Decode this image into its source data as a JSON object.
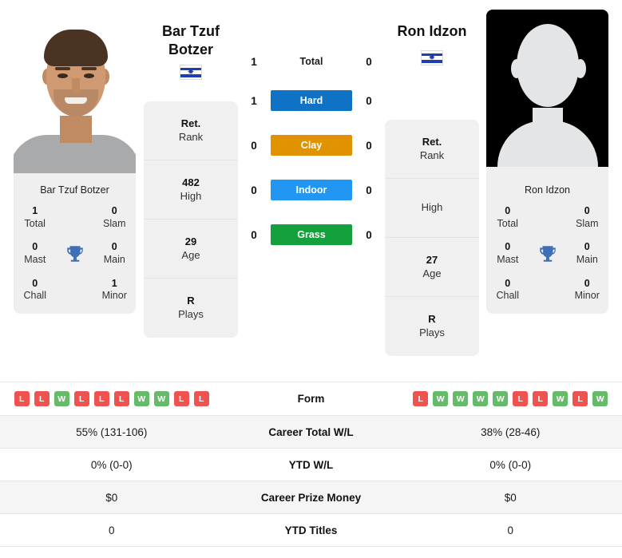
{
  "colors": {
    "win": "#66bb6a",
    "loss": "#ef5350",
    "hard": "#0f72c4",
    "clay": "#e09200",
    "indoor": "#2196f3",
    "grass": "#14a03c",
    "trophy": "#3f6fb5"
  },
  "players": {
    "left": {
      "name_line1": "Bar Tzuf",
      "name_line2": "Botzer",
      "flag": "israel-flag",
      "photo": "player-headshot",
      "titles_name": "Bar Tzuf Botzer",
      "titles": [
        {
          "value": "1",
          "label": "Total"
        },
        {
          "value": "0",
          "label": "Slam"
        },
        {
          "value": "0",
          "label": "Mast"
        },
        {
          "value": "0",
          "label": "Main"
        },
        {
          "value": "0",
          "label": "Chall"
        },
        {
          "value": "1",
          "label": "Minor"
        }
      ],
      "stats": [
        {
          "value": "Ret.",
          "label": "Rank"
        },
        {
          "value": "482",
          "label": "High"
        },
        {
          "value": "29",
          "label": "Age"
        },
        {
          "value": "R",
          "label": "Plays"
        }
      ],
      "form": [
        "L",
        "L",
        "W",
        "L",
        "L",
        "L",
        "W",
        "W",
        "L",
        "L"
      ],
      "career_total_wl": "55% (131-106)",
      "ytd_wl": "0% (0-0)",
      "career_prize_money": "$0",
      "ytd_titles": "0"
    },
    "right": {
      "name_line1": "Ron Idzon",
      "name_line2": "",
      "flag": "israel-flag",
      "photo": "player-placeholder-silhouette",
      "titles_name": "Ron Idzon",
      "titles": [
        {
          "value": "0",
          "label": "Total"
        },
        {
          "value": "0",
          "label": "Slam"
        },
        {
          "value": "0",
          "label": "Mast"
        },
        {
          "value": "0",
          "label": "Main"
        },
        {
          "value": "0",
          "label": "Chall"
        },
        {
          "value": "0",
          "label": "Minor"
        }
      ],
      "stats": [
        {
          "value": "Ret.",
          "label": "Rank"
        },
        {
          "value": "",
          "label": "High"
        },
        {
          "value": "27",
          "label": "Age"
        },
        {
          "value": "R",
          "label": "Plays"
        }
      ],
      "form": [
        "L",
        "W",
        "W",
        "W",
        "W",
        "L",
        "L",
        "W",
        "L",
        "W"
      ],
      "career_total_wl": "38% (28-46)",
      "ytd_wl": "0% (0-0)",
      "career_prize_money": "$0",
      "ytd_titles": "0"
    }
  },
  "h2h": {
    "total": {
      "label": "Total",
      "left": "1",
      "right": "0"
    },
    "surfaces": [
      {
        "label": "Hard",
        "left": "1",
        "right": "0",
        "color": "#0f72c4"
      },
      {
        "label": "Clay",
        "left": "0",
        "right": "0",
        "color": "#e09200"
      },
      {
        "label": "Indoor",
        "left": "0",
        "right": "0",
        "color": "#2196f3"
      },
      {
        "label": "Grass",
        "left": "0",
        "right": "0",
        "color": "#14a03c"
      }
    ]
  },
  "comparison": {
    "rows": [
      {
        "label": "Form",
        "left": "",
        "right": "",
        "type": "form"
      },
      {
        "label": "Career Total W/L",
        "left": "55% (131-106)",
        "right": "38% (28-46)",
        "type": "text"
      },
      {
        "label": "YTD W/L",
        "left": "0% (0-0)",
        "right": "0% (0-0)",
        "type": "text"
      },
      {
        "label": "Career Prize Money",
        "left": "$0",
        "right": "$0",
        "type": "text"
      },
      {
        "label": "YTD Titles",
        "left": "0",
        "right": "0",
        "type": "text"
      }
    ]
  }
}
